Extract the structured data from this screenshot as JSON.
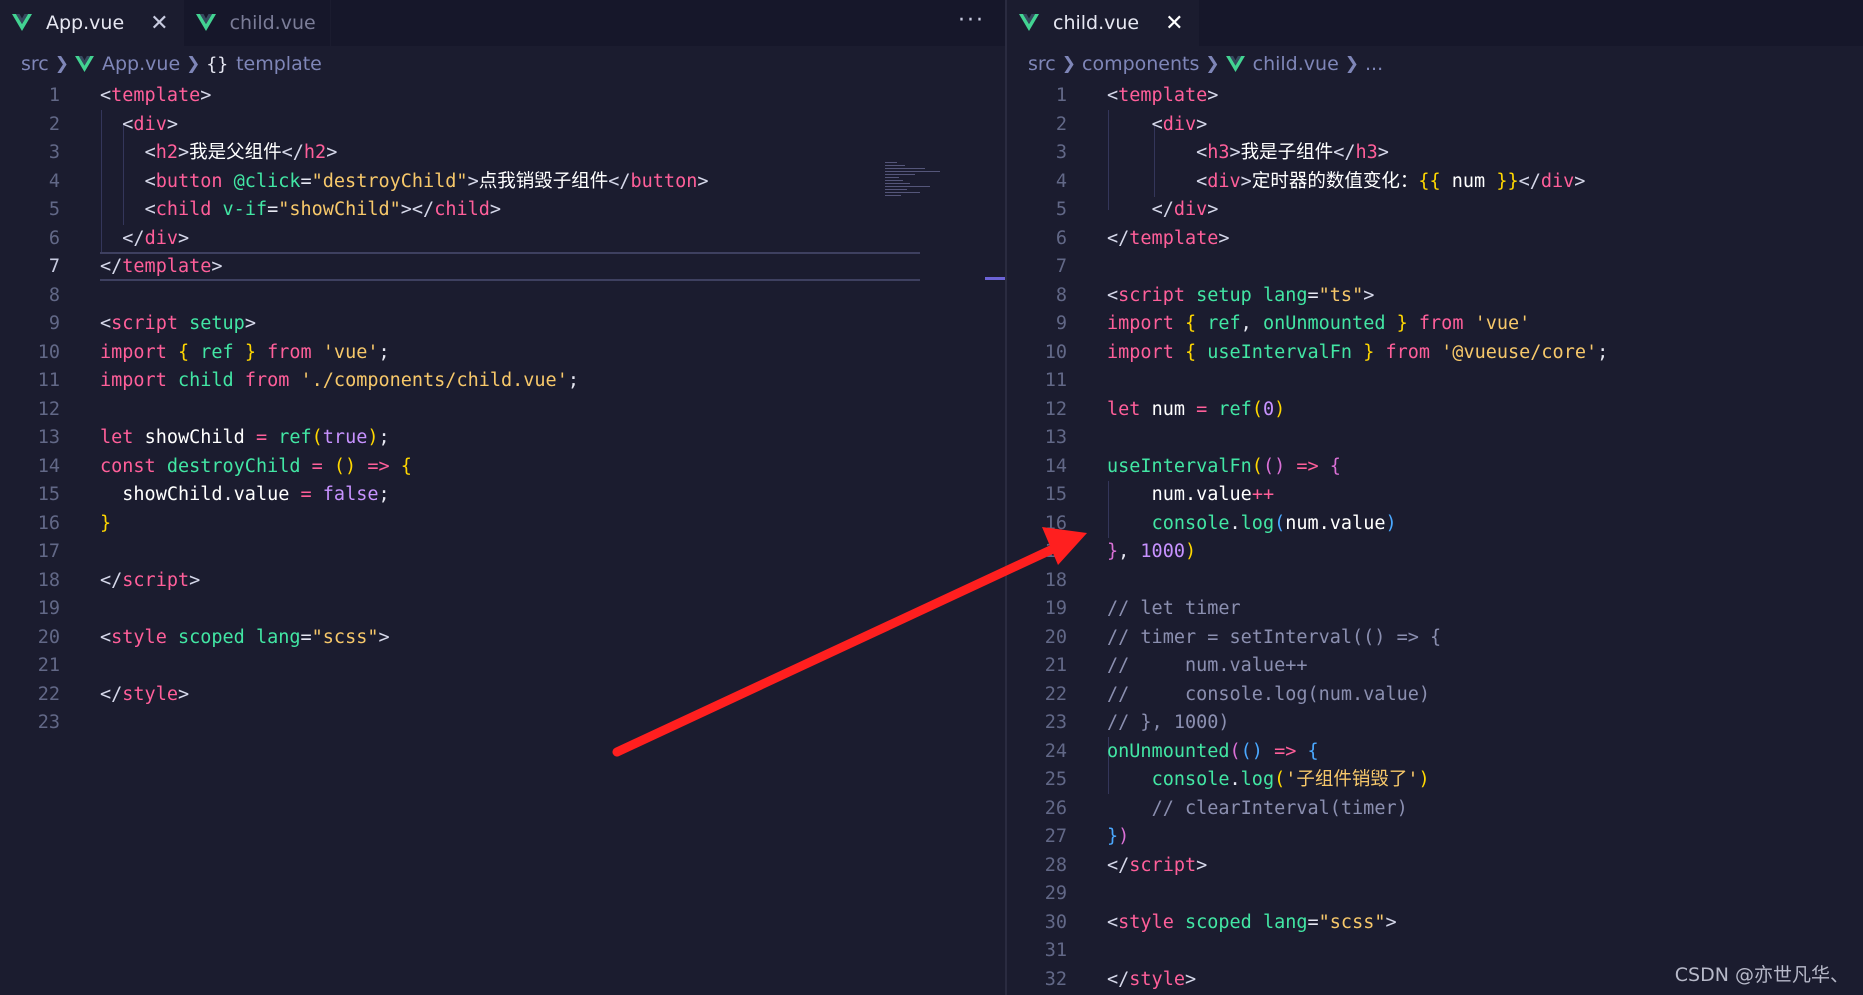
{
  "left": {
    "tabs": [
      {
        "label": "App.vue",
        "active": true
      },
      {
        "label": "child.vue",
        "active": false
      }
    ],
    "more_actions": "···",
    "breadcrumb": [
      "src",
      "App.vue",
      "template"
    ],
    "line_numbers": [
      "1",
      "2",
      "3",
      "4",
      "5",
      "6",
      "7",
      "8",
      "9",
      "10",
      "11",
      "12",
      "13",
      "14",
      "15",
      "16",
      "17",
      "18",
      "19",
      "20",
      "21",
      "22",
      "23"
    ]
  },
  "right": {
    "tabs": [
      {
        "label": "child.vue",
        "active": true
      }
    ],
    "breadcrumb": [
      "src",
      "components",
      "child.vue",
      "..."
    ],
    "line_numbers": [
      "1",
      "2",
      "3",
      "4",
      "5",
      "6",
      "7",
      "8",
      "9",
      "10",
      "11",
      "12",
      "13",
      "14",
      "15",
      "16",
      "17",
      "18",
      "19",
      "20",
      "21",
      "22",
      "23",
      "24",
      "25",
      "26",
      "27",
      "28",
      "29",
      "30",
      "31",
      "32"
    ]
  },
  "code": {
    "l1": "template",
    "l2": "div",
    "l3_tag": "h2",
    "l3_text": "我是父组件",
    "l4_tag": "button",
    "l4_attr": "@click",
    "l4_val": "\"destroyChild\"",
    "l4_text": "点我销毁子组件",
    "l5_tag": "child",
    "l5_attr": "v-if",
    "l5_val": "\"showChild\"",
    "l9_tag": "script",
    "l9_attr": "setup",
    "l10_import": "import",
    "l10_ref": "ref",
    "l10_from": "from",
    "l10_str": "'vue'",
    "l11_child": "child",
    "l11_str": "'./components/child.vue'",
    "l13_let": "let",
    "l13_var": "showChild",
    "l13_fn": "ref",
    "l13_bool": "true",
    "l14_const": "const",
    "l14_fn": "destroyChild",
    "l15_obj": "showChild",
    "l15_prop": "value",
    "l15_bool": "false",
    "l20_tag": "style",
    "l20_attr1": "scoped",
    "l20_attr2": "lang",
    "l20_val": "\"scss\""
  },
  "rcode": {
    "l3_tag": "h3",
    "l3_text": "我是子组件",
    "l4_text": "定时器的数值变化：",
    "l4_var": "num",
    "l8_val": "\"ts\"",
    "l9_ref": "ref",
    "l9_unm": "onUnmounted",
    "l10_fn": "useIntervalFn",
    "l10_str": "'@vueuse/core'",
    "l12_var": "num",
    "l12_num": "0",
    "l15": "num.value",
    "l16_obj": "console",
    "l16_fn": "log",
    "l16_arg": "num.value",
    "l17_num": "1000",
    "l19": "// let timer",
    "l20": "// timer = setInterval(() => {",
    "l21": "//     num.value++",
    "l22": "//     console.log(num.value)",
    "l23": "// }, 1000)",
    "l25_str": "'子组件销毁了'",
    "l26": "// clearInterval(timer)"
  },
  "watermark": "CSDN @亦世凡华、",
  "colors": {
    "background": "#1b1c2f",
    "tag": "#ff5f9a",
    "attr": "#42e6a4",
    "string": "#f7c86a",
    "arrow": "#ff1f1f"
  }
}
